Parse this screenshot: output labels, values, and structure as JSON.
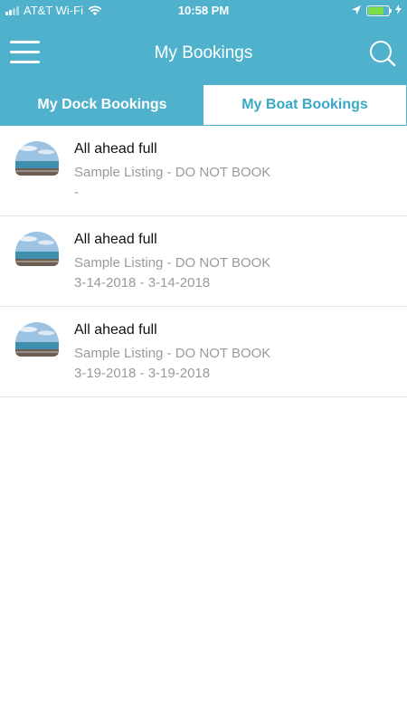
{
  "status_bar": {
    "carrier": "AT&T Wi-Fi",
    "time": "10:58 PM",
    "battery_level": 0.75,
    "icons": [
      "signal-icon",
      "wifi-icon",
      "location-icon",
      "battery-icon",
      "charging-icon"
    ]
  },
  "header": {
    "title": "My Bookings",
    "menu_icon": "hamburger-menu-icon",
    "search_icon": "search-icon"
  },
  "tabs": [
    {
      "label": "My Dock Bookings",
      "selected": false
    },
    {
      "label": "My Boat Bookings",
      "selected": true
    }
  ],
  "bookings": [
    {
      "title": "All ahead full",
      "listing": "Sample Listing - DO NOT BOOK",
      "dates": "-"
    },
    {
      "title": "All ahead full",
      "listing": "Sample Listing - DO NOT BOOK",
      "dates": "3-14-2018 - 3-14-2018"
    },
    {
      "title": "All ahead full",
      "listing": "Sample Listing - DO NOT BOOK",
      "dates": "3-19-2018 - 3-19-2018"
    }
  ],
  "colors": {
    "brand": "#4fb1cb",
    "tab_active_text": "#3aa8c5",
    "secondary_text": "#9a9a9a",
    "divider": "#e3e3e3"
  }
}
